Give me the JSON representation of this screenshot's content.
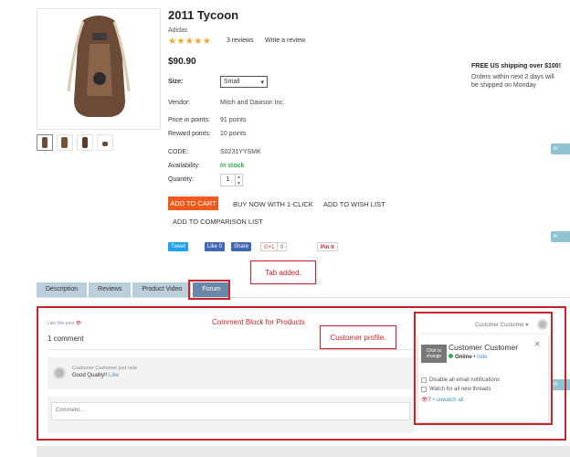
{
  "product": {
    "title": "2011 Tycoon",
    "brand": "Adidas",
    "stars": "★★★★★",
    "reviews_link": "3 reviews",
    "write_review": "Write a review",
    "price": "$90.90",
    "size_label": "Size:",
    "size_value": "Small",
    "details": [
      {
        "label": "Vendor:",
        "value": "Mitch and Dawson Inc."
      },
      {
        "label": "Price in points:",
        "value": "91 points"
      },
      {
        "label": "Reward points:",
        "value": "10 points"
      },
      {
        "label": "CODE:",
        "value": "S0231YYSMK"
      },
      {
        "label": "Availability:",
        "value": "In stock"
      },
      {
        "label": "Quantity:",
        "value": "1"
      }
    ]
  },
  "shipping": {
    "title": "FREE US shipping over $100!",
    "text": "Orders within next 2 days will be shipped on Monday"
  },
  "actions": {
    "add_to_cart": "ADD TO CART",
    "buy_now": "BUY NOW WITH 1-CLICK",
    "wishlist": "ADD TO WISH LIST",
    "comparison": "ADD TO COMPARISON LIST"
  },
  "social": {
    "tweet": "Tweet",
    "like": "Like 0",
    "share": "Share",
    "gplus": "G+1",
    "gplus_count": "0",
    "pin": "Pin it"
  },
  "side_buttons": {
    "label": "M"
  },
  "tabs": [
    "Description",
    "Reviews",
    "Product Video",
    "Forum"
  ],
  "annotations": {
    "tab_added": "Tab added.",
    "comment_block": "Comment Block for Products",
    "customer_profile": "Customer profile."
  },
  "comments": {
    "like_post": "Like this post",
    "count": "1 comment",
    "author": "Customer Customer just now",
    "text": "Good Quality!!",
    "like": "Like",
    "placeholder": "Comment..."
  },
  "profile": {
    "header": "Customer Customer",
    "click_change": "Click to change",
    "name": "Customer Customer",
    "status": "Online",
    "hide": "hide",
    "opt1": "Disable all email notifications",
    "opt2": "Watch for all new threads",
    "watch_count": "7",
    "unwatch": "unwatch all"
  },
  "colors": {
    "accent": "#f25a1d",
    "annotation": "#c9242a",
    "tab_active": "#6a86a6",
    "in_stock": "#2eae4e"
  }
}
